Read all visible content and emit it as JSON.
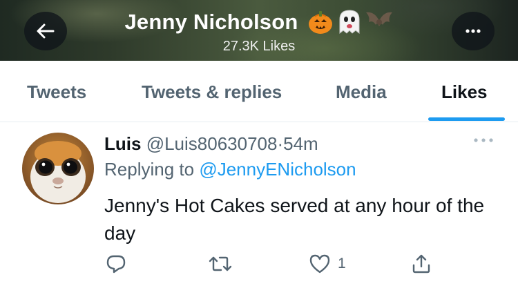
{
  "header": {
    "name": "Jenny Nicholson",
    "subtitle": "27.3K Likes",
    "emojis": [
      "jack-o-lantern",
      "ghost",
      "bat"
    ]
  },
  "tabs": [
    {
      "label": "Tweets",
      "active": false
    },
    {
      "label": "Tweets & replies",
      "active": false
    },
    {
      "label": "Media",
      "active": false
    },
    {
      "label": "Likes",
      "active": true
    }
  ],
  "tweet": {
    "author_name": "Luis",
    "author_handle": "@Luis80630708",
    "separator": "·",
    "time": "54m",
    "replying_prefix": "Replying to",
    "replying_to": "@JennyENicholson",
    "text": "Jenny's Hot Cakes served at any hour of the day",
    "likes_count": "1"
  },
  "colors": {
    "accent": "#1d9bf0",
    "text_primary": "#0f1419",
    "text_secondary": "#536471"
  }
}
